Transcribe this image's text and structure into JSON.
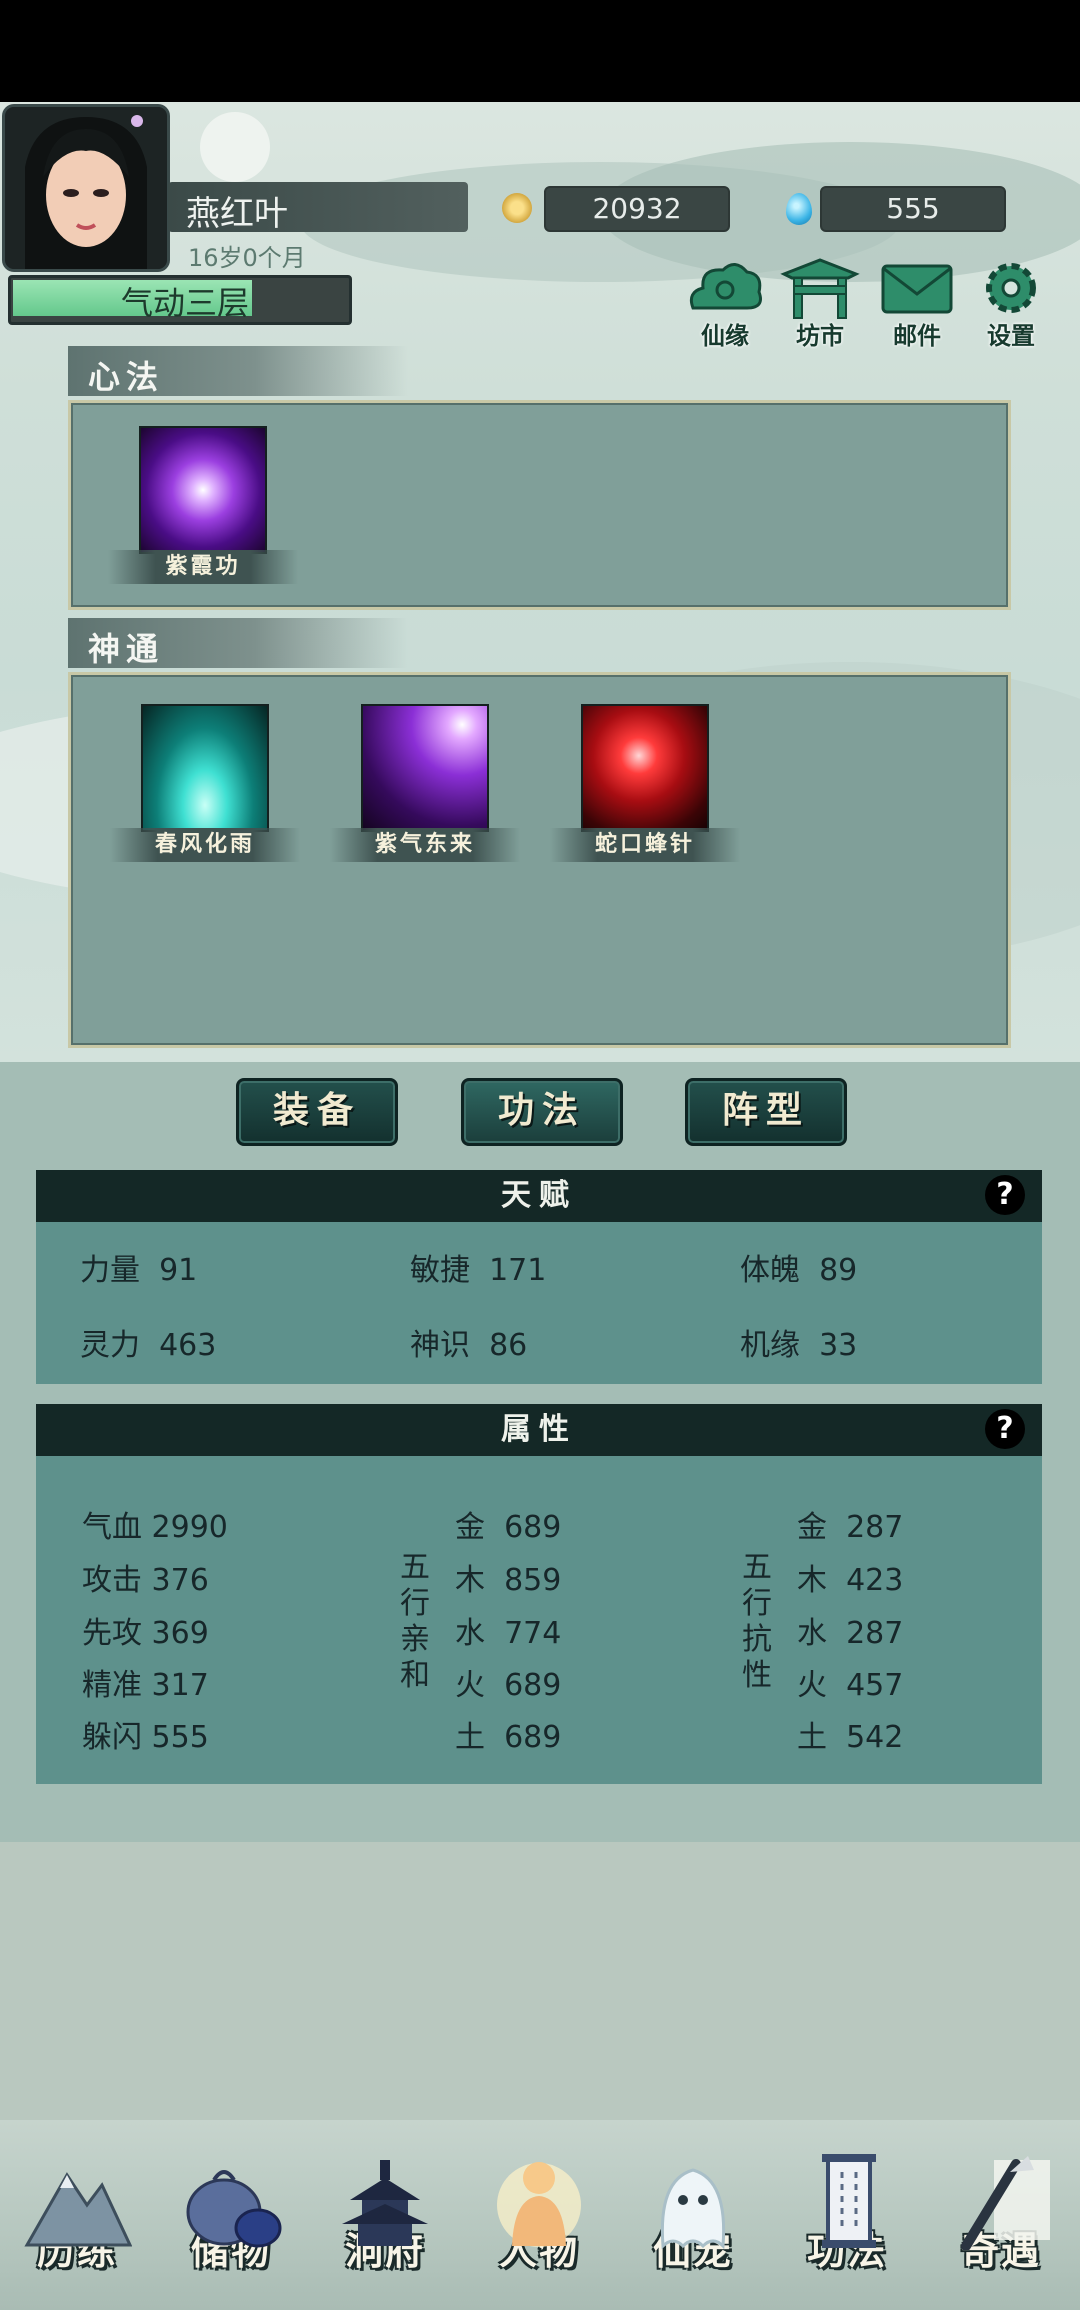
{
  "player": {
    "name": "燕红叶",
    "age": "16岁0个月",
    "realm": "气动三层",
    "realm_progress": 0.73
  },
  "resources": {
    "coins": "20932",
    "gems": "555"
  },
  "top_buttons": [
    {
      "label": "仙缘",
      "icon": "cloud-icon"
    },
    {
      "label": "坊市",
      "icon": "market-gate-icon"
    },
    {
      "label": "邮件",
      "icon": "mail-icon"
    },
    {
      "label": "设置",
      "icon": "gear-icon"
    }
  ],
  "xinfa": {
    "title": "心法",
    "skills": [
      {
        "name": "紫霞功",
        "icon": "purple-vortex-icon"
      }
    ]
  },
  "shentong": {
    "title": "神通",
    "skills": [
      {
        "name": "春风化雨",
        "icon": "cyan-rain-icon"
      },
      {
        "name": "紫气东来",
        "icon": "purple-light-icon"
      },
      {
        "name": "蛇口蜂针",
        "icon": "red-needle-icon"
      }
    ]
  },
  "tabs": [
    "装备",
    "功法",
    "阵型"
  ],
  "active_tab": "功法",
  "talent": {
    "title": "天赋",
    "help": "?",
    "stats": [
      {
        "label": "力量",
        "value": "91"
      },
      {
        "label": "敏捷",
        "value": "171"
      },
      {
        "label": "体魄",
        "value": "89"
      },
      {
        "label": "灵力",
        "value": "463"
      },
      {
        "label": "神识",
        "value": "86"
      },
      {
        "label": "机缘",
        "value": "33"
      }
    ]
  },
  "attributes": {
    "title": "属性",
    "help": "?",
    "basic": [
      {
        "label": "气血",
        "value": "2990"
      },
      {
        "label": "攻击",
        "value": "376"
      },
      {
        "label": "先攻",
        "value": "369"
      },
      {
        "label": "精准",
        "value": "317"
      },
      {
        "label": "躲闪",
        "value": "555"
      }
    ],
    "affinity_label": "五行亲和",
    "affinity": [
      {
        "label": "金",
        "value": "689"
      },
      {
        "label": "木",
        "value": "859"
      },
      {
        "label": "水",
        "value": "774"
      },
      {
        "label": "火",
        "value": "689"
      },
      {
        "label": "土",
        "value": "689"
      }
    ],
    "resistance_label": "五行抗性",
    "resistance": [
      {
        "label": "金",
        "value": "287"
      },
      {
        "label": "木",
        "value": "423"
      },
      {
        "label": "水",
        "value": "287"
      },
      {
        "label": "火",
        "value": "457"
      },
      {
        "label": "土",
        "value": "542"
      }
    ]
  },
  "nav": [
    {
      "label": "历练",
      "icon": "mountain-icon"
    },
    {
      "label": "储物",
      "icon": "bag-icon"
    },
    {
      "label": "洞府",
      "icon": "pagoda-icon"
    },
    {
      "label": "人物",
      "icon": "person-icon"
    },
    {
      "label": "仙宠",
      "icon": "ghost-pet-icon"
    },
    {
      "label": "功法",
      "icon": "scroll-icon"
    },
    {
      "label": "奇遇",
      "icon": "brush-icon"
    }
  ],
  "colors": {
    "panel": "#809f99",
    "stat_box": "#5e918c",
    "stat_head": "#142826",
    "tab": "#1b3e3b"
  }
}
